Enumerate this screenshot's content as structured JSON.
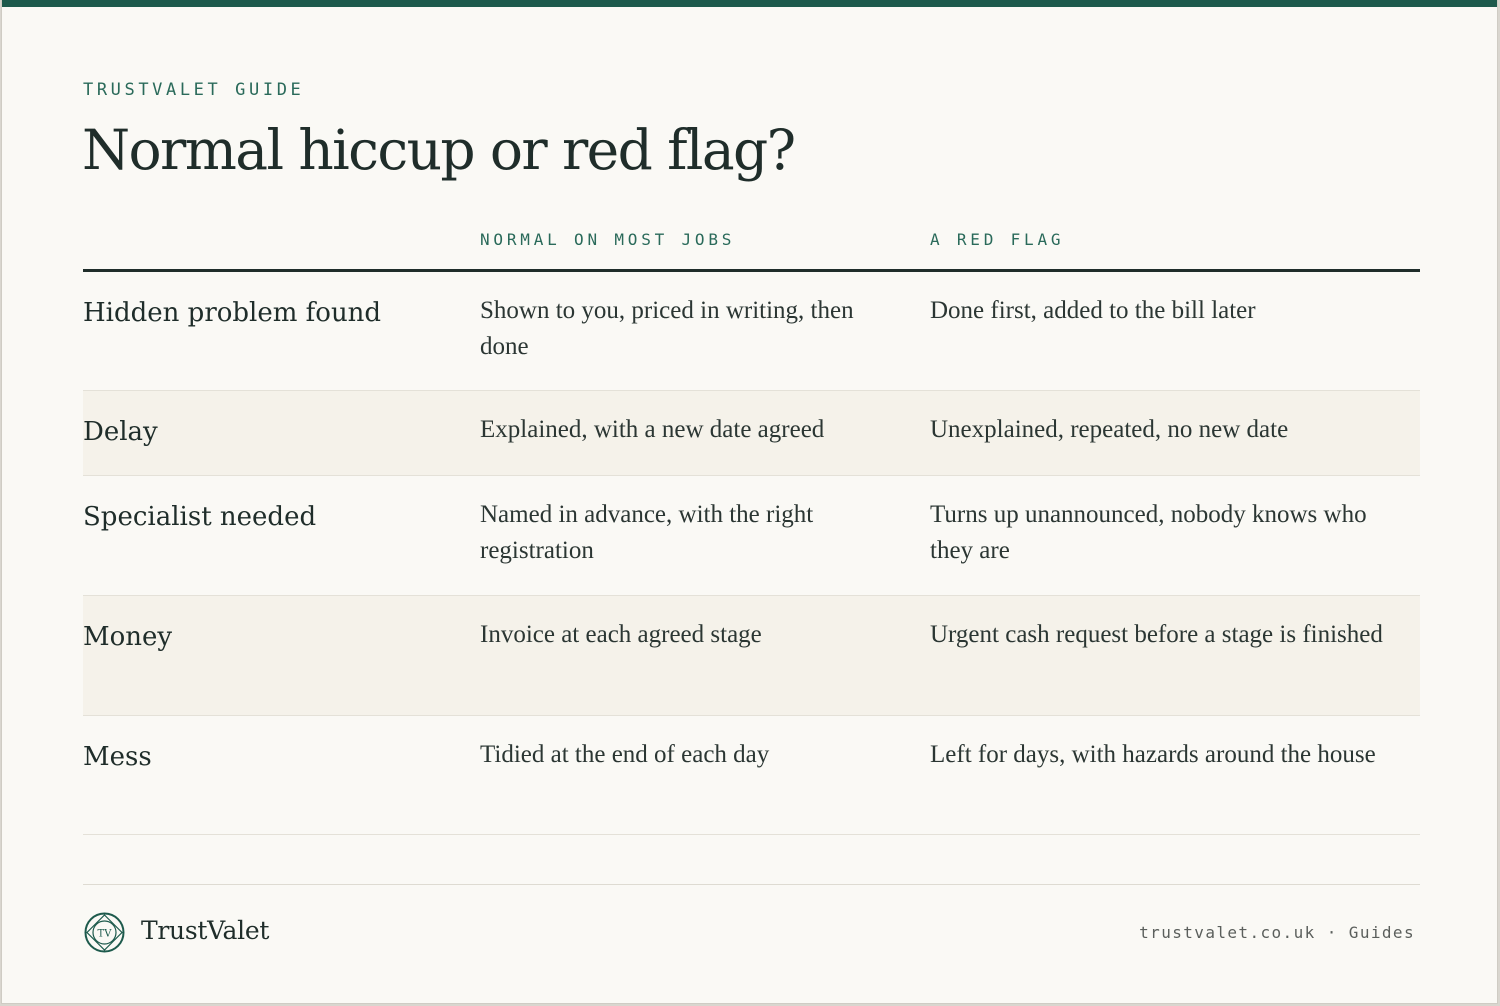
{
  "eyebrow": "TRUSTVALET GUIDE",
  "title": "Normal hiccup or red flag?",
  "columns": {
    "normal": "NORMAL ON MOST JOBS",
    "red_flag": "A RED FLAG"
  },
  "rows": [
    {
      "label": "Hidden problem found",
      "normal": "Shown to you, priced in writing, then done",
      "red_flag": "Done first, added to the bill later"
    },
    {
      "label": "Delay",
      "normal": "Explained, with a new date agreed",
      "red_flag": "Unexplained, repeated, no new date"
    },
    {
      "label": "Specialist needed",
      "normal": "Named in advance, with the right registration",
      "red_flag": "Turns up unannounced, nobody knows who they are"
    },
    {
      "label": "Money",
      "normal": "Invoice at each agreed stage",
      "red_flag": "Urgent cash request before a stage is finished"
    },
    {
      "label": "Mess",
      "normal": "Tidied at the end of each day",
      "red_flag": "Left for days, with hazards around the house"
    }
  ],
  "footer": {
    "logo_icon": "tv-monogram-icon",
    "logo_monogram": "TV",
    "brand": "TrustValet",
    "site": "trustvalet.co.uk",
    "separator": "·",
    "section": "Guides"
  },
  "colors": {
    "accent": "#1d5a4c",
    "background": "#faf9f5",
    "shaded_row": "#f5f2ea",
    "text": "#1f2d2a"
  }
}
